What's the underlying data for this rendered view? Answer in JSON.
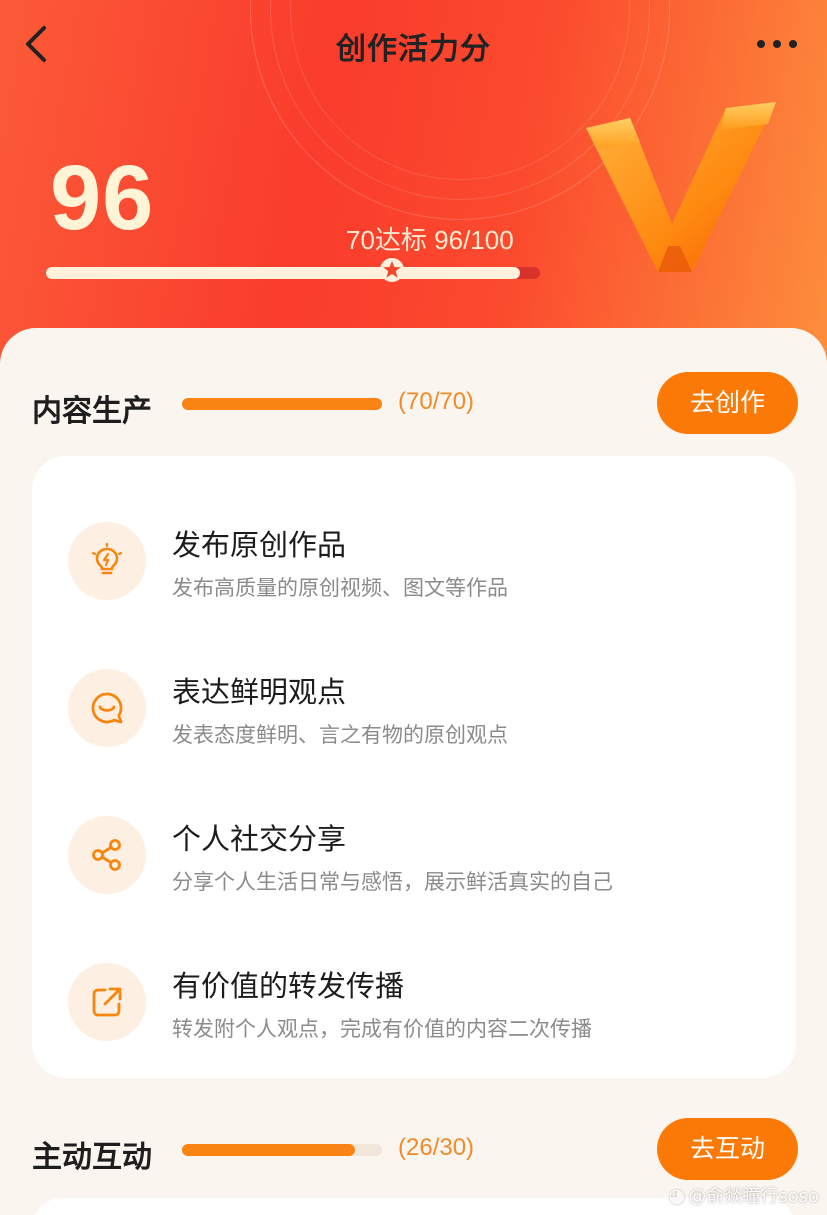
{
  "header": {
    "title": "创作活力分"
  },
  "hero": {
    "score": "96",
    "meta": "70达标 96/100",
    "progress": 0.96,
    "target_fraction": 0.7
  },
  "sections": [
    {
      "title": "内容生产",
      "count": "(70/70)",
      "progress": 1.0,
      "button": "去创作",
      "items": [
        {
          "icon": "lightbulb-icon",
          "title": "发布原创作品",
          "subtitle": "发布高质量的原创视频、图文等作品"
        },
        {
          "icon": "speech-smile-icon",
          "title": "表达鲜明观点",
          "subtitle": "发表态度鲜明、言之有物的原创观点"
        },
        {
          "icon": "share-icon",
          "title": "个人社交分享",
          "subtitle": "分享个人生活日常与感悟，展示鲜活真实的自己"
        },
        {
          "icon": "forward-icon",
          "title": "有价值的转发传播",
          "subtitle": "转发附个人观点，完成有价值的内容二次传播"
        }
      ]
    },
    {
      "title": "主动互动",
      "count": "(26/30)",
      "progress": 0.8667,
      "button": "去互动"
    }
  ],
  "watermark": "@俞燚瞳行soso",
  "colors": {
    "accent": "#fb7a07",
    "hero_red": "#fa3c2c",
    "icon_bg": "#fdefe2"
  }
}
